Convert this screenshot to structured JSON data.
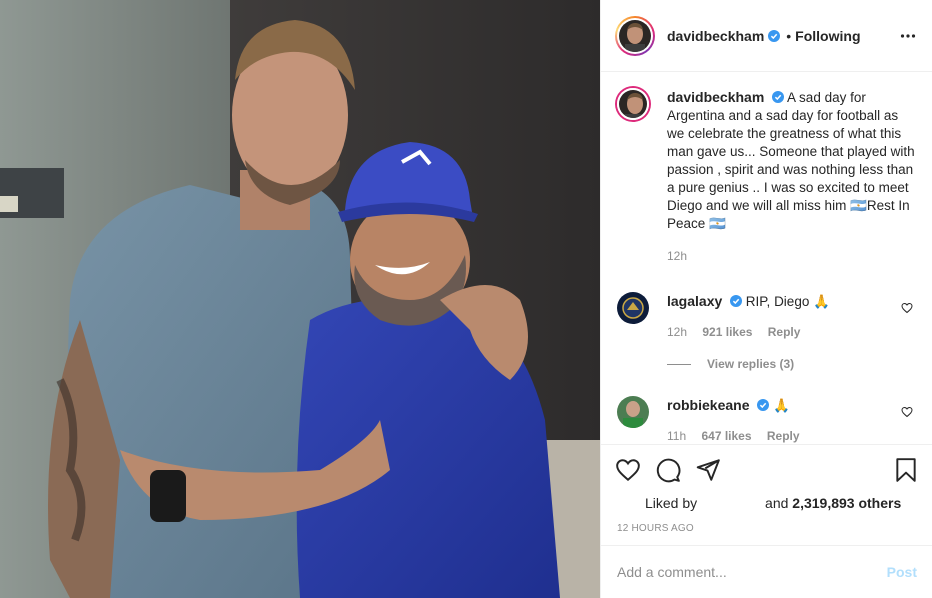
{
  "post": {
    "author": "davidbeckham",
    "follow_dot": "•",
    "follow_status": "Following",
    "more_icon": "more-horizontal-icon",
    "caption": "A sad day for Argentina and a sad day for football as we celebrate the greatness of what this man gave us... Someone that played with passion , spirit and was nothing less than a pure genius .. I was so excited to meet Diego and we will all miss him 🇦🇷Rest In Peace 🇦🇷",
    "caption_time": "12h"
  },
  "comments": [
    {
      "user": "lagalaxy",
      "text": "RIP, Diego 🙏",
      "time": "12h",
      "likes": "921 likes",
      "reply": "Reply",
      "view_replies": "View replies (3)"
    },
    {
      "user": "robbiekeane",
      "text": "🙏",
      "time": "11h",
      "likes": "647 likes",
      "reply": "Reply"
    }
  ],
  "actions": {
    "like_icon": "heart-icon",
    "comment_icon": "comment-icon",
    "share_icon": "paper-plane-icon",
    "save_icon": "bookmark-icon"
  },
  "likes": {
    "prefix": "Liked by",
    "suffix_and": "and",
    "count_text": "2,319,893 others"
  },
  "timestamp": "12 HOURS AGO",
  "add_comment": {
    "placeholder": "Add a comment...",
    "post_label": "Post"
  },
  "colors": {
    "verified": "#3897f0",
    "post_disabled": "#b2dffc",
    "muted": "#8e8e8e"
  }
}
